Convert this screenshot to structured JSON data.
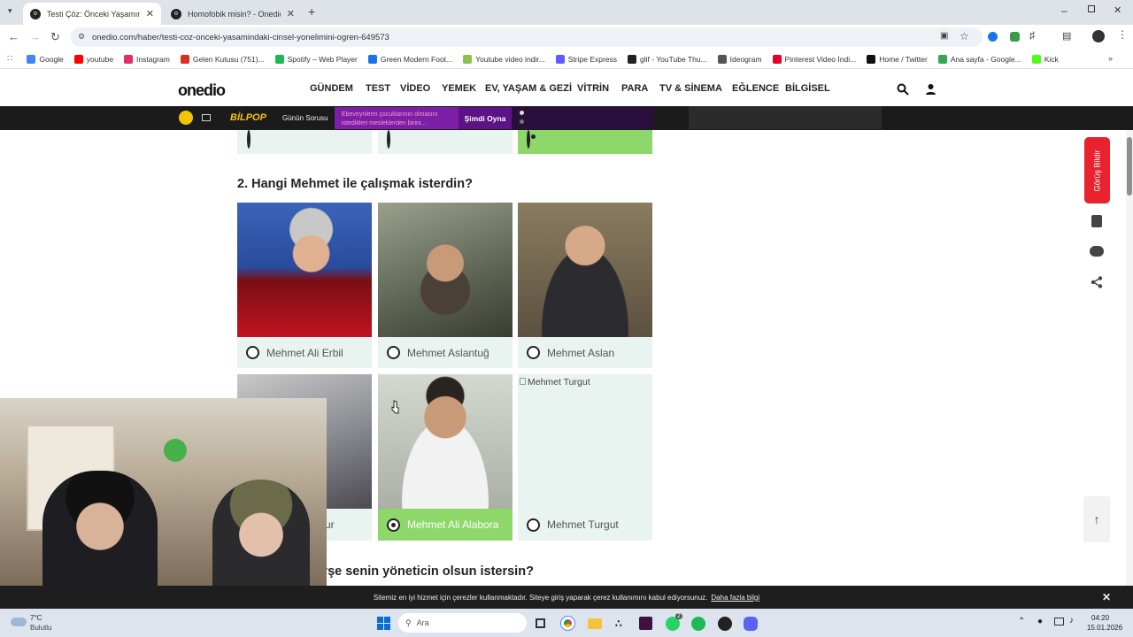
{
  "browser": {
    "tabs": [
      {
        "title": "Testi Çöz: Önceki Yaşamındaki Cinsel",
        "active": true
      },
      {
        "title": "Homofobik misin? - Onedio",
        "active": false
      }
    ],
    "new_tab": "+",
    "url": "onedio.com/haber/testi-coz-onceki-yasamindaki-cinsel-yonelimini-ogren-649573",
    "bookmarks": [
      "Google",
      "youtube",
      "Instagram",
      "Gelen Kutusu (751)...",
      "Spotify – Web Player",
      "Green Modern Foot...",
      "Youtube video indir...",
      "Stripe Express",
      "glif - YouTube Thu...",
      "Ideogram",
      "Pinterest Video İndi...",
      "Home / Twitter",
      "Ana sayfa - Google...",
      "Kick"
    ],
    "bookmark_colors": [
      "#4285f4",
      "#ff0000",
      "#e1306c",
      "#d93025",
      "#1db954",
      "#1a73e8",
      "#8bc34a",
      "#635bff",
      "#222222",
      "#555555",
      "#e60023",
      "#111111",
      "#34a853",
      "#53fc18"
    ]
  },
  "site": {
    "logo": "onedio",
    "menu": [
      "GÜNDEM",
      "TEST",
      "VİDEO",
      "YEMEK",
      "EV, YAŞAM & GEZİ",
      "VİTRİN",
      "PARA",
      "TV & SİNEMA",
      "EĞLENCE",
      "BİLGİSEL"
    ],
    "bilpop": {
      "brand": "BİLPOP",
      "label": "Günün Sorusu",
      "question": "Ebeveynlerin çocuklarının olmasını istedikleri mesleklerden birini...",
      "cta": "Şimdi Oyna"
    },
    "feedback": "Görüş Bildir"
  },
  "quiz": {
    "question2": "2. Hangi Mehmet ile çalışmak isterdin?",
    "options": [
      {
        "label": "Mehmet Ali Erbil",
        "selected": false
      },
      {
        "label": "Mehmet Aslantuğ",
        "selected": false
      },
      {
        "label": "Mehmet Aslan",
        "selected": false
      },
      {
        "label": "sur",
        "selected": false
      },
      {
        "label": "Mehmet Ali Alabora",
        "selected": true
      },
      {
        "label": "Mehmet Turgut",
        "selected": false
      }
    ],
    "broken_image_alt": "Mehmet Turgut",
    "question3_partial": "yşe senin yöneticin olsun istersin?"
  },
  "cookie": {
    "text": "Sitemiz en iyi hizmet için çerezler kullanmaktadır. Siteye giriş yaparak çerez kullanımını kabul ediyorsunuz.",
    "link": "Daha fazla bilgi",
    "close": "✕"
  },
  "taskbar": {
    "weather_temp": "7°C",
    "weather_desc": "Bulutlu",
    "search": "Ara",
    "time": "04:20",
    "date": "15.01.2026",
    "badge1": "2"
  }
}
